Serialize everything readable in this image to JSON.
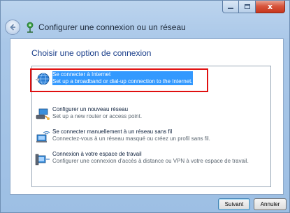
{
  "window": {
    "title": "Configurer une connexion ou un réseau",
    "controls": {
      "minimize": "–",
      "maximize": "□",
      "close": "x"
    }
  },
  "main": {
    "heading": "Choisir une option de connexion",
    "options": [
      {
        "title": "Se connecter à Internet",
        "desc": "Set up a broadband or dial-up connection to the Internet.",
        "selected": true,
        "icon": "internet-globe-icon"
      },
      {
        "title": "Configurer un nouveau réseau",
        "desc": "Set up a new router or access point.",
        "selected": false,
        "icon": "router-icon"
      },
      {
        "title": "Se connecter manuellement à un réseau sans fil",
        "desc": "Connectez-vous à un réseau masqué ou créez un profil sans fil.",
        "selected": false,
        "icon": "wireless-network-icon"
      },
      {
        "title": "Connexion à votre espace de travail",
        "desc": "Configurer une connexion d'accès à distance ou VPN à votre espace de travail.",
        "selected": false,
        "icon": "workplace-vpn-icon"
      }
    ]
  },
  "footer": {
    "next_label": "Suivant",
    "cancel_label": "Annuler"
  },
  "colors": {
    "selection": "#3399ff",
    "highlight_box": "#e01010",
    "heading": "#1a3e8a"
  }
}
